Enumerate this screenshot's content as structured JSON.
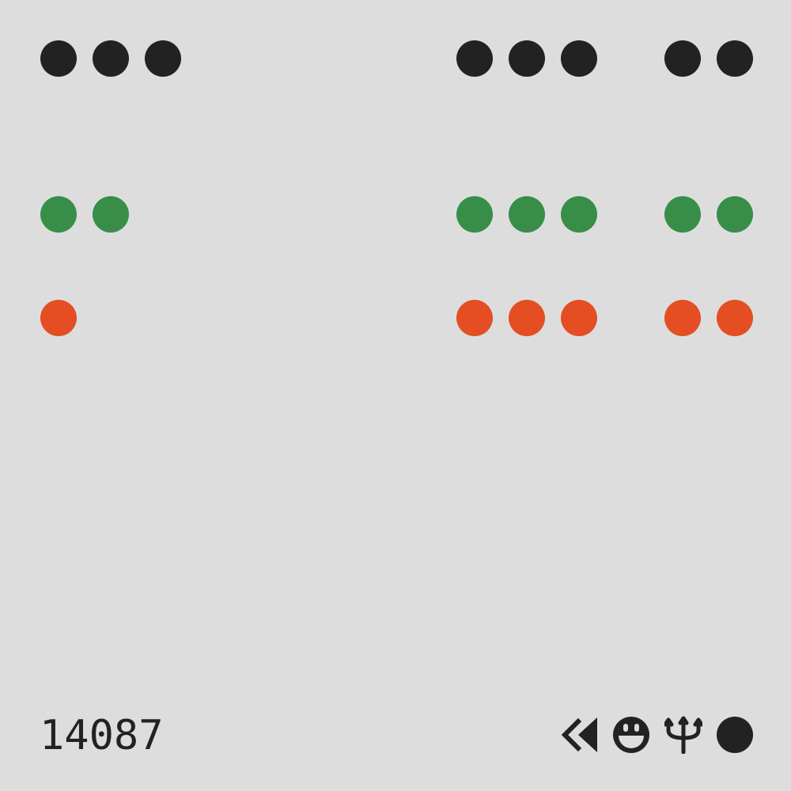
{
  "colors": {
    "background": "#dddddd",
    "black": "#222222",
    "green": "#388e48",
    "orange": "#e44e22"
  },
  "rows": [
    {
      "name": "black-row",
      "color": "#222222",
      "groups": [
        3,
        3,
        2
      ]
    },
    {
      "name": "green-row",
      "color": "#388e48",
      "groups": [
        2,
        3,
        2
      ]
    },
    {
      "name": "orange-row",
      "color": "#e44e22",
      "groups": [
        1,
        3,
        2
      ]
    }
  ],
  "footer": {
    "serial": "14087",
    "icons": [
      "rewind-icon",
      "grinning-face-icon",
      "trident-icon",
      "circle-icon"
    ]
  }
}
